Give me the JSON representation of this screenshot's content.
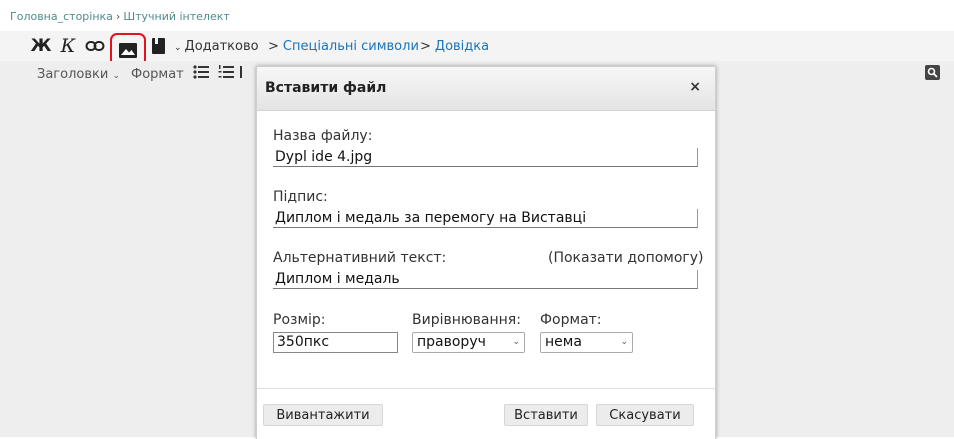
{
  "breadcrumb": {
    "home": "Головна_сторінка",
    "separator": "›",
    "current": "Штучний інтелект"
  },
  "toolbar": {
    "bold_label": "Ж",
    "italic_label": "К",
    "extra_label": "Додатково",
    "special_symbols_label": "Спеціальні символи",
    "help_label": "Довідка",
    "link_arrow": ">"
  },
  "format_bar": {
    "headings_label": "Заголовки",
    "format_label": "Формат"
  },
  "dialog": {
    "title": "Вставити файл",
    "close_label": "×",
    "filename_label": "Назва файлу:",
    "filename_value": "Dypl ide 4.jpg",
    "caption_label": "Підпис:",
    "caption_value": "Диплом і медаль за перемогу на Виставці",
    "alt_label": "Альтернативний текст:",
    "alt_help_link": "(Показати допомогу)",
    "alt_value": "Диплом і медаль",
    "size_label": "Розмір:",
    "size_value": "350пкс",
    "align_label": "Вирівнювання:",
    "align_value": "праворуч",
    "format_label": "Формат:",
    "format_value": "нема",
    "upload_button": "Вивантажити",
    "insert_button": "Вставити",
    "cancel_button": "Скасувати"
  },
  "colors": {
    "highlight": "#e0141b",
    "link": "#1b73b8",
    "breadcrumb_link": "#4f8b8b"
  }
}
